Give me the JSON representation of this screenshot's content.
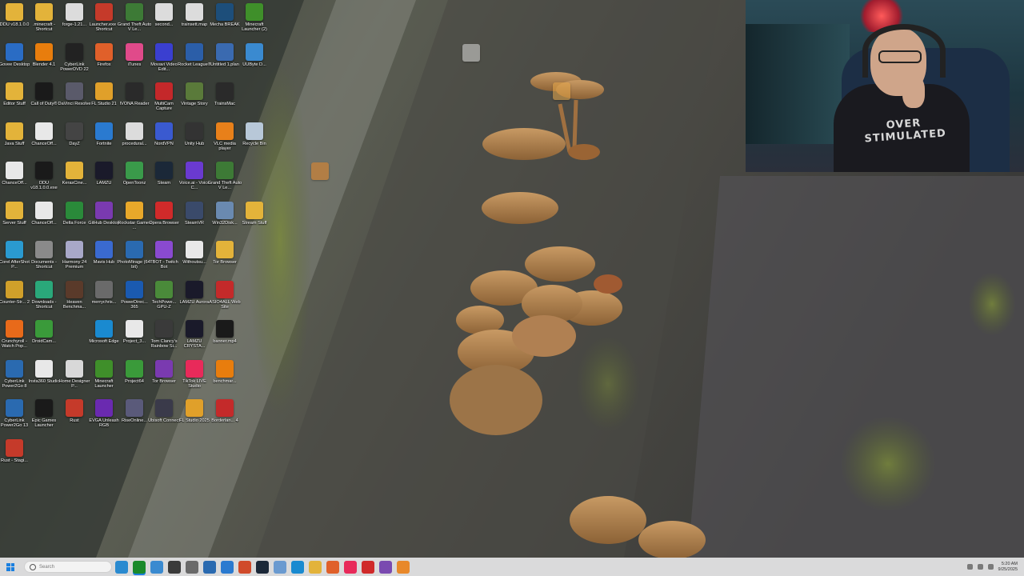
{
  "desktop_icons": [
    {
      "label": "DDU v18.1.0.0",
      "icon": "folder-icon",
      "color": "#e3b33a"
    },
    {
      "label": ".minecraft - Shortcut",
      "icon": "folder-icon",
      "color": "#e3b33a"
    },
    {
      "label": "forge-1.21...",
      "icon": "file-icon",
      "color": "#dcdcdc"
    },
    {
      "label": "Launcher.exe - Shortcut",
      "icon": "rust-icon",
      "color": "#c53a2a"
    },
    {
      "label": "Grand Theft Auto V Le...",
      "icon": "gta-icon",
      "color": "#3d7a36"
    },
    {
      "label": "second...",
      "icon": "file-icon",
      "color": "#dcdcdc"
    },
    {
      "label": "trainsett.map",
      "icon": "file-icon",
      "color": "#dcdcdc"
    },
    {
      "label": "Mecha BREAK",
      "icon": "game-icon",
      "color": "#1d4e7a"
    },
    {
      "label": "Minecraft Launcher (2)",
      "icon": "minecraft-icon",
      "color": "#3f8f2a"
    },
    {
      "label": "Govee Desktop",
      "icon": "govee-icon",
      "color": "#2a6cc4"
    },
    {
      "label": "Blender 4.1",
      "icon": "blender-icon",
      "color": "#e87d0d"
    },
    {
      "label": "CyberLink PowerDVD 22",
      "icon": "powerdvd-icon",
      "color": "#222"
    },
    {
      "label": "Firefox",
      "icon": "firefox-icon",
      "color": "#e0602a"
    },
    {
      "label": "iTunes",
      "icon": "itunes-icon",
      "color": "#e04a8a"
    },
    {
      "label": "Movavi Video Edit...",
      "icon": "movavi-icon",
      "color": "#3a3fd0"
    },
    {
      "label": "Rocket League®",
      "icon": "rocket-league-icon",
      "color": "#2b5ea8"
    },
    {
      "label": "Untitled 1.plan",
      "icon": "plan-icon",
      "color": "#3a6ab0"
    },
    {
      "label": "UUByte D...",
      "icon": "uubyte-icon",
      "color": "#3a8ad0"
    },
    {
      "label": "Editor Stuff",
      "icon": "folder-icon",
      "color": "#e3b33a"
    },
    {
      "label": "Call of Duty®",
      "icon": "cod-icon",
      "color": "#1a1a1a"
    },
    {
      "label": "DaVinci Resolve",
      "icon": "davinci-icon",
      "color": "#5a5a6a"
    },
    {
      "label": "FL Studio 21",
      "icon": "flstudio-icon",
      "color": "#e0a02a"
    },
    {
      "label": "IVONA Reader",
      "icon": "ivona-icon",
      "color": "#2a2a2a"
    },
    {
      "label": "MultiCam Capture",
      "icon": "multicam-icon",
      "color": "#c4282a"
    },
    {
      "label": "Vintage Story",
      "icon": "vintage-story-icon",
      "color": "#5a7a3a"
    },
    {
      "label": "TrainsMac",
      "icon": "trains-icon",
      "color": "#2a2a2a"
    },
    {
      "label": "Java Stuff",
      "icon": "folder-icon",
      "color": "#e3b33a"
    },
    {
      "label": "ChanceOff...",
      "icon": "video-file-icon",
      "color": "#e8e8e8"
    },
    {
      "label": "DayZ",
      "icon": "dayz-icon",
      "color": "#444"
    },
    {
      "label": "Fortnite",
      "icon": "fortnite-icon",
      "color": "#2a7ad0"
    },
    {
      "label": "procedural...",
      "icon": "file-icon",
      "color": "#dcdcdc"
    },
    {
      "label": "NordVPN",
      "icon": "nordvpn-icon",
      "color": "#3a5ad0"
    },
    {
      "label": "Unity Hub",
      "icon": "unity-icon",
      "color": "#333"
    },
    {
      "label": "VLC media player",
      "icon": "vlc-icon",
      "color": "#e8801a"
    },
    {
      "label": "Recycle Bin",
      "icon": "recycle-bin-icon",
      "color": "#b8c8d8"
    },
    {
      "label": "ChanceOff...",
      "icon": "video-file-icon",
      "color": "#e8e8e8"
    },
    {
      "label": "DDU v18.1.0.0.exe",
      "icon": "7zip-icon",
      "color": "#1a1a1a"
    },
    {
      "label": "KerasCine...",
      "icon": "folder-icon",
      "color": "#e3b33a"
    },
    {
      "label": "LAMZU",
      "icon": "lamzu-icon",
      "color": "#1a1a2a"
    },
    {
      "label": "OpenToonz",
      "icon": "opentoonz-icon",
      "color": "#3a9a4a"
    },
    {
      "label": "Steam",
      "icon": "steam-icon",
      "color": "#1b2838"
    },
    {
      "label": "Voice.ai - Voice C...",
      "icon": "voiceai-icon",
      "color": "#6a3ad0"
    },
    {
      "label": "Grand Theft Auto V Le...",
      "icon": "gta-icon",
      "color": "#3d7a36"
    },
    {
      "label": "Server Stuff",
      "icon": "folder-icon",
      "color": "#e3b33a"
    },
    {
      "label": "ChanceOff...",
      "icon": "video-file-icon",
      "color": "#e8e8e8"
    },
    {
      "label": "Delta Force",
      "icon": "delta-force-icon",
      "color": "#2a8a3a"
    },
    {
      "label": "GitHub Desktop",
      "icon": "github-icon",
      "color": "#7a3ab0"
    },
    {
      "label": "Rockstar Games ...",
      "icon": "rockstar-icon",
      "color": "#e8a82a"
    },
    {
      "label": "Opera Browser",
      "icon": "opera-icon",
      "color": "#d02a2a"
    },
    {
      "label": "SteamVR",
      "icon": "steamvr-icon",
      "color": "#3a4a6a"
    },
    {
      "label": "Win32Disk...",
      "icon": "disk-icon",
      "color": "#6a8ab0"
    },
    {
      "label": "Stream Stuff",
      "icon": "folder-icon",
      "color": "#e3b33a"
    },
    {
      "label": "Corel AfterShot P...",
      "icon": "aftershot-icon",
      "color": "#2a9ad0"
    },
    {
      "label": "Documents - Shortcut",
      "icon": "documents-icon",
      "color": "#8a8a8a"
    },
    {
      "label": "Harmony 24 Premium",
      "icon": "harmony-icon",
      "color": "#a8a8c8"
    },
    {
      "label": "Mavis Hub",
      "icon": "mavis-icon",
      "color": "#3a6ad0"
    },
    {
      "label": "PhotoMirage (64-bit)",
      "icon": "photomirage-icon",
      "color": "#2a6ab0"
    },
    {
      "label": "TBOT - Twitch Bot",
      "icon": "tbot-icon",
      "color": "#8a4ad0"
    },
    {
      "label": "Withoutsu...",
      "icon": "video-file-icon",
      "color": "#e8e8e8"
    },
    {
      "label": "Tor Browser",
      "icon": "folder-icon",
      "color": "#e3b33a"
    },
    {
      "label": "Counter-Str... 2",
      "icon": "cs2-icon",
      "color": "#d0a02a"
    },
    {
      "label": "Downloads - Shortcut",
      "icon": "downloads-icon",
      "color": "#2aa87a"
    },
    {
      "label": "Heaven Benchma...",
      "icon": "heaven-icon",
      "color": "#5a3a2a"
    },
    {
      "label": "merrychris...",
      "icon": "image-file-icon",
      "color": "#6a6a6a"
    },
    {
      "label": "PowerDirec... 365",
      "icon": "powerdirector-icon",
      "color": "#1a5ab0"
    },
    {
      "label": "TechPowe... GPU-Z",
      "icon": "gpuz-icon",
      "color": "#4a8a3a"
    },
    {
      "label": "LAMZU Aurora",
      "icon": "lamzu-icon",
      "color": "#1a1a2a"
    },
    {
      "label": "ASIO4ALL Web Site",
      "icon": "asio-icon",
      "color": "#c42a2a"
    },
    {
      "label": "Crunchyroll - Watch Pop...",
      "icon": "crunchyroll-icon",
      "color": "#e86a1a"
    },
    {
      "label": "DroidCam...",
      "icon": "droidcam-icon",
      "color": "#3a9a3a"
    },
    {
      "label": "",
      "icon": "empty",
      "color": "transparent"
    },
    {
      "label": "Microsoft Edge",
      "icon": "edge-icon",
      "color": "#1a8ad0"
    },
    {
      "label": "Project_3...",
      "icon": "video-file-icon",
      "color": "#e8e8e8"
    },
    {
      "label": "Tom Clancy's Rainbow Si...",
      "icon": "rainbow-six-icon",
      "color": "#3a3a3a"
    },
    {
      "label": "LAMZU CRYSTA...",
      "icon": "lamzu-icon",
      "color": "#1a1a2a"
    },
    {
      "label": "banner.mp4",
      "icon": "video-file-icon",
      "color": "#1a1a1a"
    },
    {
      "label": "CyberLink Power2Go 8",
      "icon": "power2go-icon",
      "color": "#2a6ab0"
    },
    {
      "label": "Insta360 Studio",
      "icon": "insta360-icon",
      "color": "#e8e8e8"
    },
    {
      "label": "Home Designer P...",
      "icon": "home-designer-icon",
      "color": "#d8d8d8"
    },
    {
      "label": "Minecraft Launcher",
      "icon": "minecraft-icon",
      "color": "#3f8f2a"
    },
    {
      "label": "Project64",
      "icon": "project64-icon",
      "color": "#3a9a3a"
    },
    {
      "label": "Tor Browser",
      "icon": "tor-icon",
      "color": "#7a3ab0"
    },
    {
      "label": "TikTok LIVE Studio",
      "icon": "tiktok-icon",
      "color": "#e82a5a"
    },
    {
      "label": "benchmar...",
      "icon": "blender-icon",
      "color": "#e87d0d"
    },
    {
      "label": "CyberLink Power2Go 13",
      "icon": "power2go-icon",
      "color": "#2a6ab0"
    },
    {
      "label": "Epic Games Launcher",
      "icon": "epic-games-icon",
      "color": "#1a1a1a"
    },
    {
      "label": "Rust",
      "icon": "rust-icon",
      "color": "#c53a2a"
    },
    {
      "label": "EVGA Unleash RGB",
      "icon": "evga-icon",
      "color": "#6a2ab0"
    },
    {
      "label": "RiseOnline...",
      "icon": "rise-online-icon",
      "color": "#5a5a7a"
    },
    {
      "label": "Ubisoft Connect",
      "icon": "ubisoft-icon",
      "color": "#3a3a4a"
    },
    {
      "label": "FL Studio 2025",
      "icon": "flstudio-icon",
      "color": "#e0a02a"
    },
    {
      "label": "Borderlan... 4",
      "icon": "borderlands-icon",
      "color": "#c42a2a"
    },
    {
      "label": "Rust - Stagi...",
      "icon": "rust-icon",
      "color": "#c53a2a"
    }
  ],
  "floating_icons": [
    {
      "label": "",
      "icon": "app-icon",
      "color": "#d8d8d8"
    },
    {
      "label": "",
      "icon": "folder-icon",
      "color": "#e8a84a"
    },
    {
      "label": "",
      "icon": "app-icon",
      "color": "#e8882a"
    }
  ],
  "webcam": {
    "shirt_text": "OVER STIMULATED"
  },
  "taskbar": {
    "search_placeholder": "Search",
    "pinned": [
      {
        "icon": "copilot-icon",
        "color": "#2a8ad0"
      },
      {
        "icon": "xbox-icon",
        "color": "#1a8a2a"
      },
      {
        "icon": "chrome-icon",
        "color": "#3a8ad0"
      },
      {
        "icon": "obs-icon",
        "color": "#3a3a3a"
      },
      {
        "icon": "gear-icon",
        "color": "#6a6a6a"
      },
      {
        "icon": "store-icon",
        "color": "#2a6ab0"
      },
      {
        "icon": "notepad-icon",
        "color": "#2a7ad0"
      },
      {
        "icon": "paint-icon",
        "color": "#d04a2a"
      },
      {
        "icon": "steam-icon",
        "color": "#1b2838"
      },
      {
        "icon": "app-icon",
        "color": "#6a9ad0"
      },
      {
        "icon": "edge-icon",
        "color": "#1a8ad0"
      },
      {
        "icon": "folder-icon",
        "color": "#e3b33a"
      },
      {
        "icon": "firefox-icon",
        "color": "#e0602a"
      },
      {
        "icon": "tiktok-icon",
        "color": "#e82a5a"
      },
      {
        "icon": "opera-icon",
        "color": "#d02a2a"
      },
      {
        "icon": "app-icon",
        "color": "#7a4ab0"
      },
      {
        "icon": "app-icon",
        "color": "#e8882a"
      }
    ],
    "clock_time": "5:20 AM",
    "clock_date": "9/25/2025"
  }
}
